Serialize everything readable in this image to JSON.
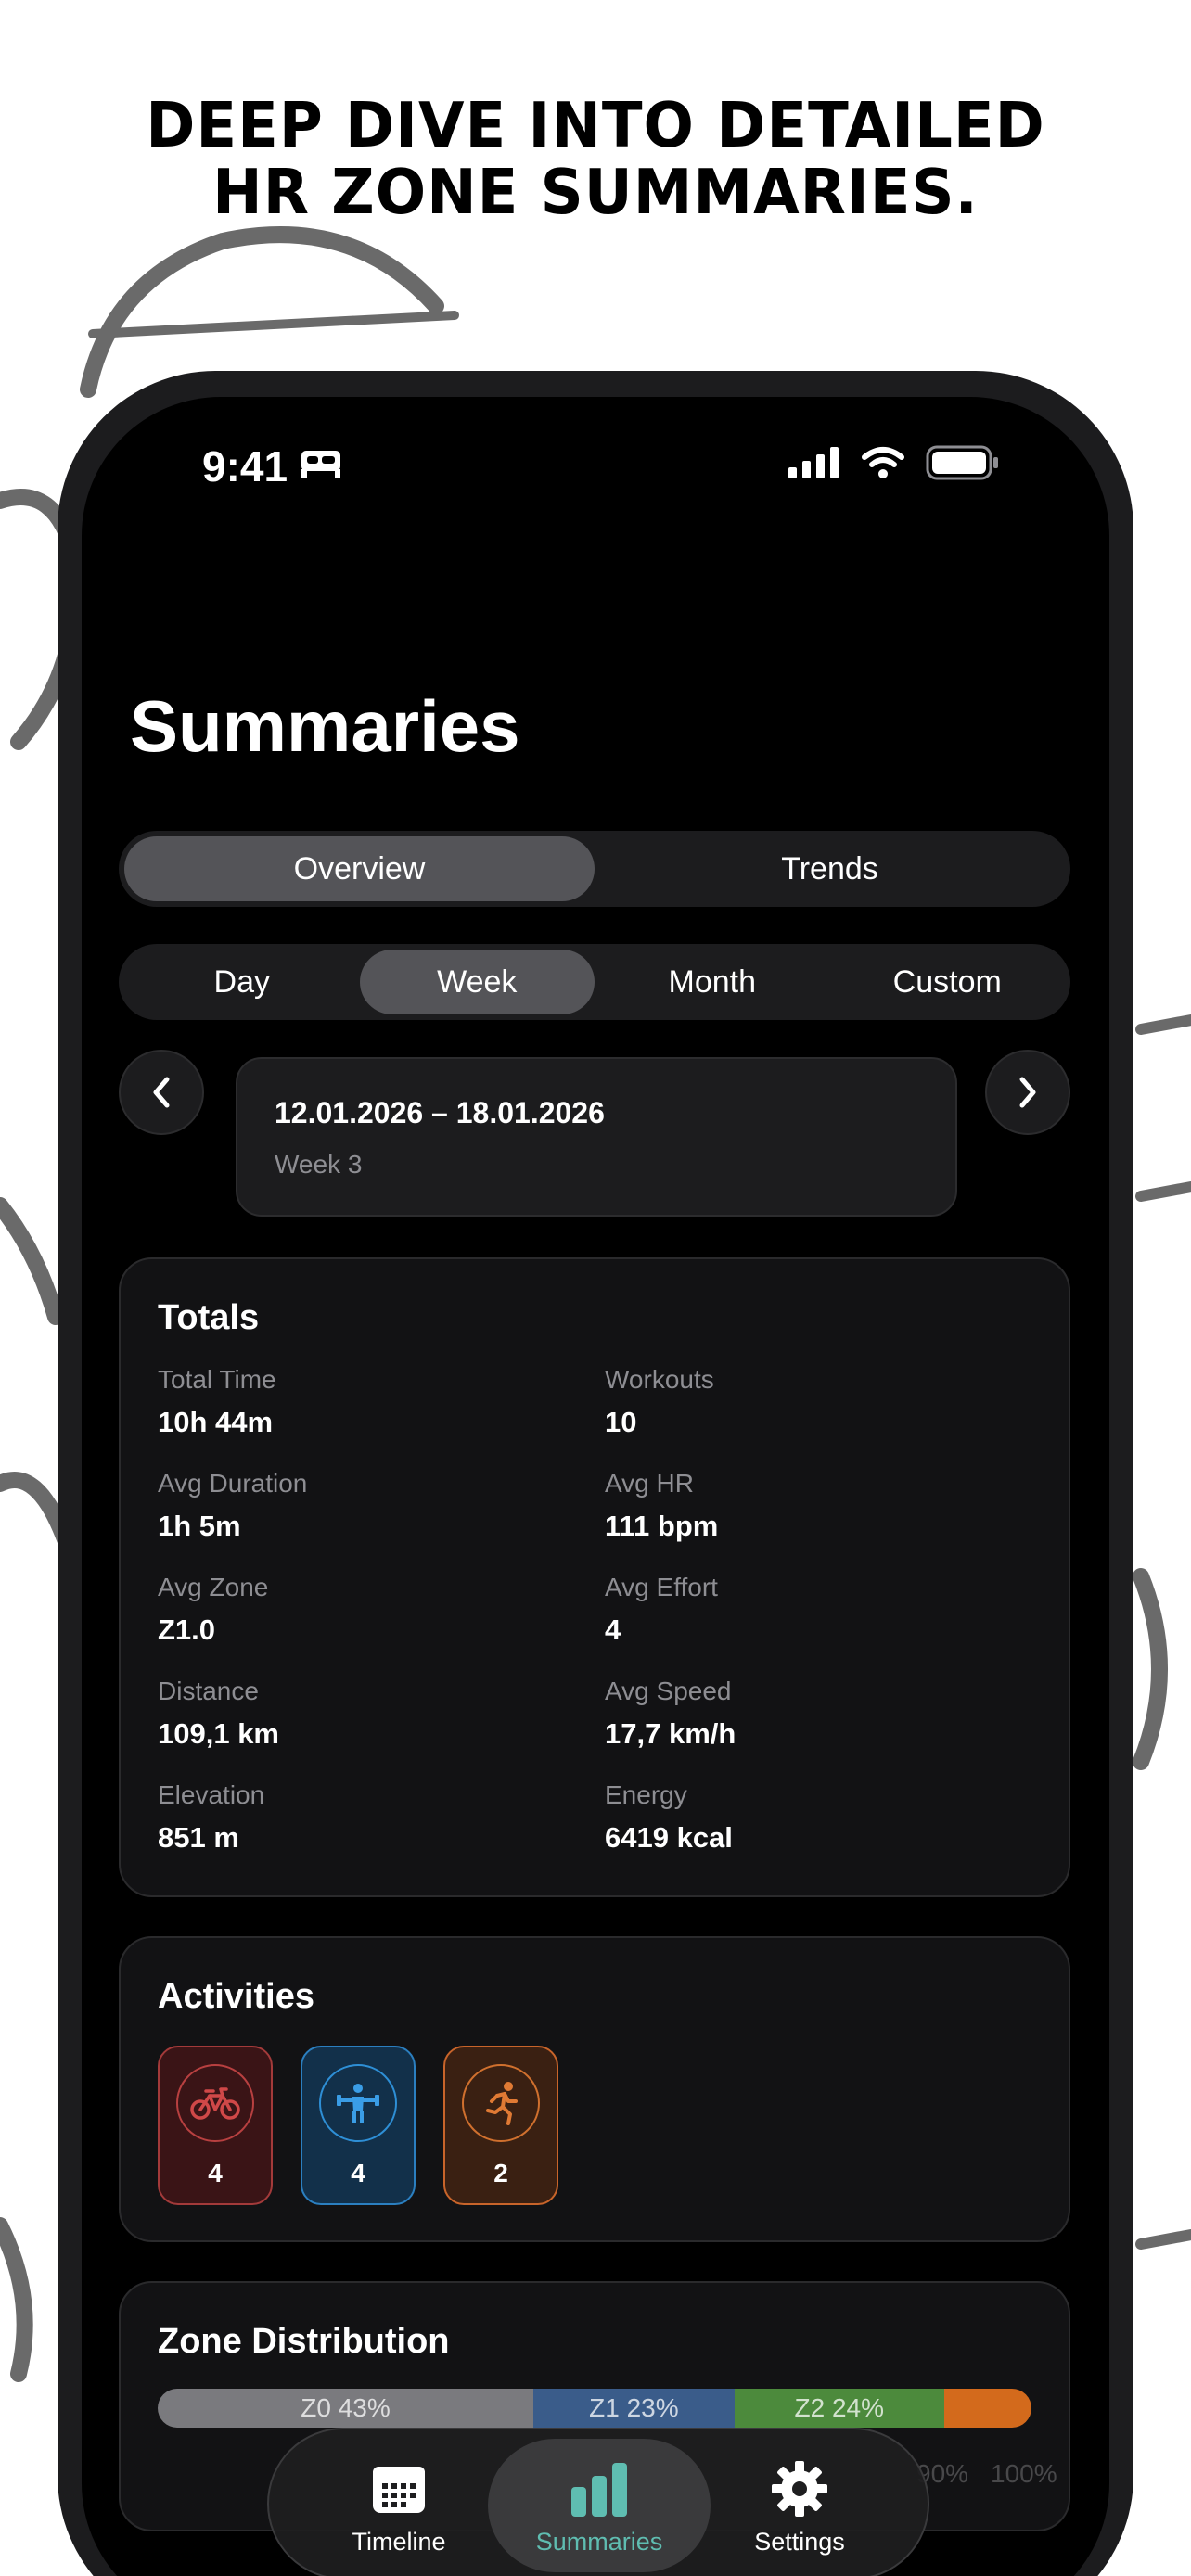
{
  "headline": {
    "line1": "Deep dive into detailed",
    "line2": "HR zone summaries."
  },
  "status_bar": {
    "time": "9:41"
  },
  "page_title": "Summaries",
  "view_tabs": [
    {
      "label": "Overview",
      "active": true
    },
    {
      "label": "Trends",
      "active": false
    }
  ],
  "period_tabs": [
    {
      "label": "Day",
      "active": false
    },
    {
      "label": "Week",
      "active": true
    },
    {
      "label": "Month",
      "active": false
    },
    {
      "label": "Custom",
      "active": false
    }
  ],
  "date_picker": {
    "range": "12.01.2026 – 18.01.2026",
    "week": "Week 3"
  },
  "totals": {
    "title": "Totals",
    "stats": [
      {
        "label": "Total Time",
        "value": "10h 44m"
      },
      {
        "label": "Workouts",
        "value": "10"
      },
      {
        "label": "Avg Duration",
        "value": "1h 5m"
      },
      {
        "label": "Avg HR",
        "value": "111 bpm"
      },
      {
        "label": "Avg Zone",
        "value": "Z1.0"
      },
      {
        "label": "Avg Effort",
        "value": "4"
      },
      {
        "label": "Distance",
        "value": "109,1 km"
      },
      {
        "label": "Avg Speed",
        "value": "17,7 km/h"
      },
      {
        "label": "Elevation",
        "value": "851 m"
      },
      {
        "label": "Energy",
        "value": "6419 kcal"
      }
    ]
  },
  "activities": {
    "title": "Activities",
    "items": [
      {
        "icon": "bike-icon",
        "count": "4",
        "color": "#b84040"
      },
      {
        "icon": "strength-icon",
        "count": "4",
        "color": "#2e8fd6"
      },
      {
        "icon": "running-icon",
        "count": "2",
        "color": "#d0702e"
      }
    ]
  },
  "zone_distribution": {
    "title": "Zone Distribution",
    "zones": [
      {
        "label": "Z0 43%",
        "percent": 43,
        "color": "#7a7a7e"
      },
      {
        "label": "Z1 23%",
        "percent": 23,
        "color": "#3a5c8a"
      },
      {
        "label": "Z2 24%",
        "percent": 24,
        "color": "#4c8a3c"
      },
      {
        "label": "",
        "percent": 10,
        "color": "#d36a1c"
      }
    ],
    "axis": [
      "90%",
      "100%"
    ]
  },
  "tab_bar": [
    {
      "label": "Timeline",
      "icon": "calendar-icon",
      "active": false
    },
    {
      "label": "Summaries",
      "icon": "bar-chart-icon",
      "active": true
    },
    {
      "label": "Settings",
      "icon": "gear-icon",
      "active": false
    }
  ]
}
